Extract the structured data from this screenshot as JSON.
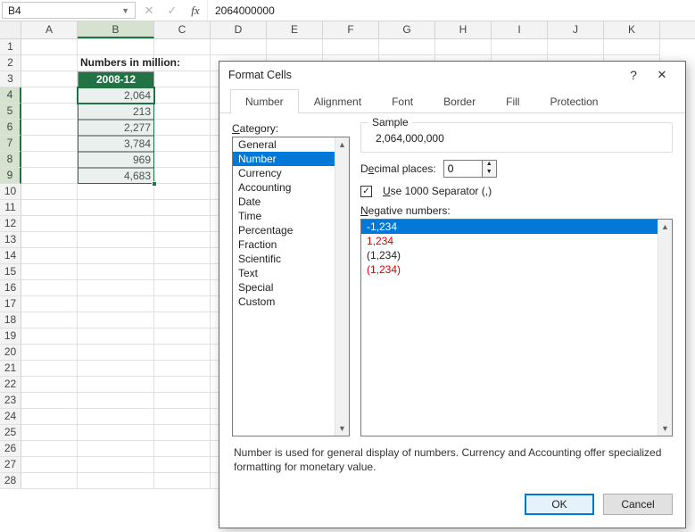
{
  "name_box": {
    "value": "B4"
  },
  "formula_bar": {
    "value": "2064000000",
    "fx_label": "fx",
    "cancel_glyph": "✕",
    "enter_glyph": "✓"
  },
  "columns": [
    "A",
    "B",
    "C",
    "D",
    "E",
    "F",
    "G",
    "H",
    "I",
    "J",
    "K"
  ],
  "rows": [
    1,
    2,
    3,
    4,
    5,
    6,
    7,
    8,
    9,
    10,
    11,
    12,
    13,
    14,
    15,
    16,
    17,
    18,
    19,
    20,
    21,
    22,
    23,
    24,
    25,
    26,
    27,
    28
  ],
  "sheet": {
    "b2_label": "Numbers in million:",
    "b3_header": "2008-12",
    "b_values": [
      "2,064",
      "213",
      "2,277",
      "3,784",
      "969",
      "4,683"
    ]
  },
  "dialog": {
    "title": "Format Cells",
    "help_glyph": "?",
    "close_glyph": "✕",
    "tabs": [
      "Number",
      "Alignment",
      "Font",
      "Border",
      "Fill",
      "Protection"
    ],
    "active_tab": 0,
    "category_label": "Category:",
    "categories": [
      "General",
      "Number",
      "Currency",
      "Accounting",
      "Date",
      "Time",
      "Percentage",
      "Fraction",
      "Scientific",
      "Text",
      "Special",
      "Custom"
    ],
    "selected_category": 1,
    "sample_label": "Sample",
    "sample_value": "2,064,000,000",
    "decimal_label_pre": "D",
    "decimal_label_underline": "e",
    "decimal_label_post": "cimal places:",
    "decimal_places": "0",
    "separator_pre": "",
    "separator_underline": "U",
    "separator_post": "se 1000 Separator (,)",
    "separator_checked": true,
    "negative_label_pre": "",
    "negative_label_underline": "N",
    "negative_label_post": "egative numbers:",
    "negative_options": [
      {
        "text": "-1,234",
        "red": false
      },
      {
        "text": "1,234",
        "red": true
      },
      {
        "text": "(1,234)",
        "red": false
      },
      {
        "text": "(1,234)",
        "red": true
      }
    ],
    "selected_negative": 0,
    "description": "Number is used for general display of numbers.  Currency and Accounting offer specialized formatting for monetary value.",
    "ok_label": "OK",
    "cancel_label": "Cancel"
  }
}
